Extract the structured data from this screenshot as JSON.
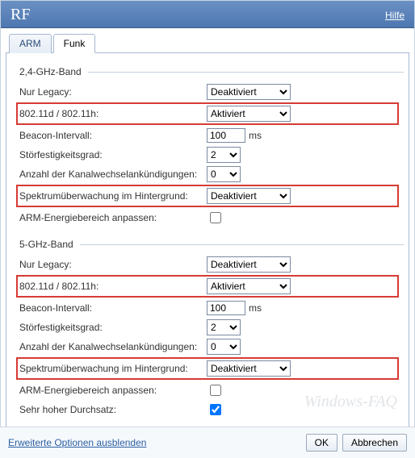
{
  "header": {
    "title": "RF",
    "help": "Hilfe"
  },
  "tabs": {
    "arm": "ARM",
    "funk": "Funk"
  },
  "labels": {
    "nur_legacy": "Nur Legacy:",
    "dot11dh": "802.11d / 802.11h:",
    "beacon": "Beacon-Intervall:",
    "stoer": "Störfestigkeitsgrad:",
    "kanal": "Anzahl der Kanalwechselankündigungen:",
    "spektrum": "Spektrumüberwachung im Hintergrund:",
    "arm_energie": "ARM-Energiebereich anpassen:",
    "sehr_hoher": "Sehr hoher Durchsatz:",
    "ms": "ms"
  },
  "band24": {
    "legend": "2,4-GHz-Band",
    "nur_legacy": "Deaktiviert",
    "dot11dh": "Aktiviert",
    "beacon": "100",
    "stoer": "2",
    "kanal": "0",
    "spektrum": "Deaktiviert",
    "arm_energie": false
  },
  "band5": {
    "legend": "5-GHz-Band",
    "nur_legacy": "Deaktiviert",
    "dot11dh": "Aktiviert",
    "beacon": "100",
    "stoer": "2",
    "kanal": "0",
    "spektrum": "Deaktiviert",
    "arm_energie": false,
    "sehr_hoher": true
  },
  "footer": {
    "advanced": "Erweiterte Optionen ausblenden",
    "ok": "OK",
    "cancel": "Abbrechen"
  },
  "watermark": "Windows-FAQ"
}
